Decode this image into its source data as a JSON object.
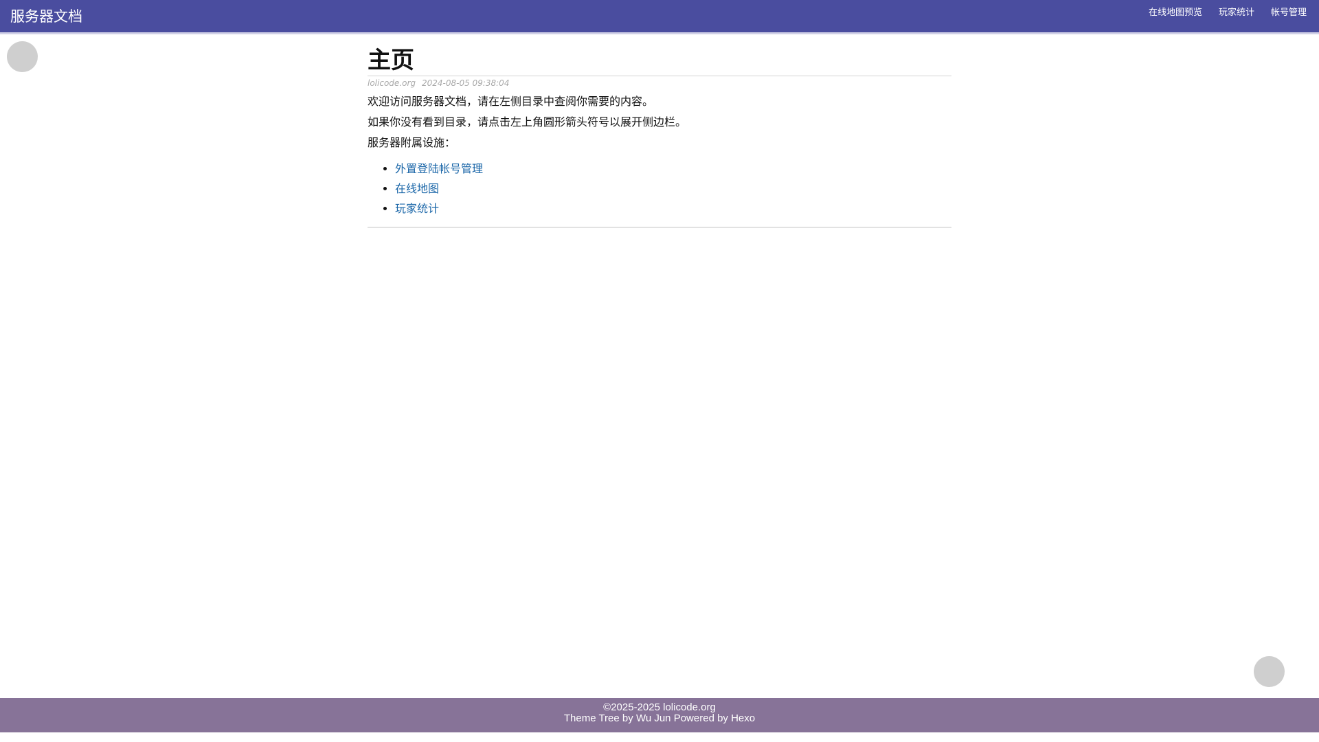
{
  "header": {
    "brand": "服务器文档",
    "nav": [
      {
        "label": "在线地图预览"
      },
      {
        "label": "玩家统计"
      },
      {
        "label": "帐号管理"
      }
    ]
  },
  "buttons": {
    "toc_toggle_icon": "",
    "scroll_top_icon": ""
  },
  "main": {
    "title": "主页",
    "meta": {
      "site": "lolicode.org",
      "datetime": "2024-08-05 09:38:04"
    },
    "paragraphs": [
      "欢迎访问服务器文档，请在左侧目录中查阅你需要的内容。",
      "如果你没有看到目录，请点击左上角圆形箭头符号以展开侧边栏。",
      "服务器附属设施："
    ],
    "links": [
      {
        "label": "外置登陆帐号管理"
      },
      {
        "label": "在线地图"
      },
      {
        "label": "玩家统计"
      }
    ]
  },
  "footer": {
    "copyright": "©2025-2025 lolicode.org",
    "theme_prefix": "Theme",
    "theme_name": "Tree",
    "by": "by",
    "author": "Wu Jun",
    "powered_by": "Powered by",
    "engine": "Hexo"
  },
  "colors": {
    "header_bg": "#4a4d9f",
    "footer_bg": "#877398",
    "link": "#1a66a8"
  }
}
